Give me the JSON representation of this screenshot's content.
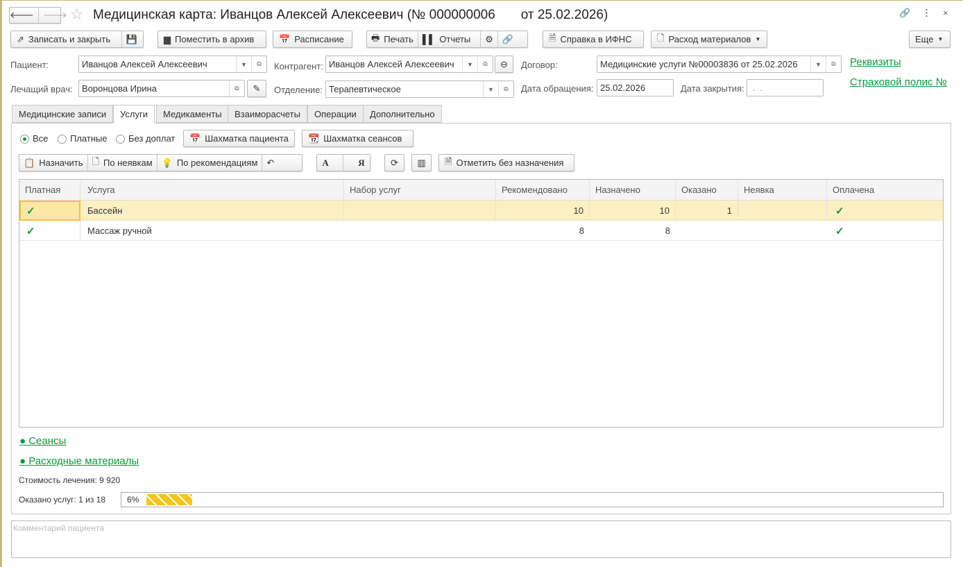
{
  "window": {
    "title": "Медицинская карта: Иванцов Алексей Алексеевич (№ 000000006       от 25.02.2026)"
  },
  "toolbar": {
    "save_close": "Записать и закрыть",
    "archive": "Поместить в архив",
    "schedule": "Расписание",
    "print": "Печать",
    "reports": "Отчеты",
    "ifns": "Справка в ИФНС",
    "materials": "Расход материалов",
    "more": "Еще"
  },
  "form": {
    "patient_label": "Пациент:",
    "patient": "Иванцов Алексей Алексеевич",
    "doctor_label": "Лечащий врач:",
    "doctor": "Воронцова Ирина",
    "contractor_label": "Контрагент:",
    "contractor": "Иванцов Алексей Алексеевич",
    "department_label": "Отделение:",
    "department": "Терапевтическое",
    "contract_label": "Договор:",
    "contract": "Медицинские услуги №00003836 от 25.02.2026",
    "visit_date_label": "Дата обращения:",
    "visit_date": "25.02.2026",
    "close_date_label": "Дата закрытия:",
    "close_date": " .  .",
    "requisites_link": "Реквизиты",
    "policy_link": "Страховой полис №"
  },
  "tabs": [
    "Медицинские записи",
    "Услуги",
    "Медикаменты",
    "Взаиморасчеты",
    "Операции",
    "Дополнительно"
  ],
  "filter": {
    "all": "Все",
    "paid": "Платные",
    "no_extra": "Без доплат",
    "selected": "Все"
  },
  "services_toolbar": {
    "patient_grid": "Шахматка пациента",
    "sessions_grid": "Шахматка сеансов",
    "assign": "Назначить",
    "no_show": "По неявкам",
    "recommend": "По рекомендациям",
    "sort_a": "А",
    "sort_z": "Я",
    "mark": "Отметить без назначения"
  },
  "table": {
    "headers": [
      "Платная",
      "Услуга",
      "Набор услуг",
      "Рекомендовано",
      "Назначено",
      "Оказано",
      "Неявка",
      "Оплачена"
    ],
    "rows": [
      {
        "paid": "✓",
        "service": "Бассейн",
        "set": "",
        "recommended": "10",
        "assigned": "10",
        "done": "1",
        "no_show": "",
        "payed": "✓"
      },
      {
        "paid": "✓",
        "service": "Массаж ручной",
        "set": "",
        "recommended": "8",
        "assigned": "8",
        "done": "",
        "no_show": "",
        "payed": "✓"
      }
    ]
  },
  "sessions_link": "● Сеансы",
  "materials_link": "● Расходные материалы",
  "cost": "Стоимость лечения: 9 920",
  "progress": {
    "label": "Оказано услуг: 1 из 18",
    "percent_text": "6%",
    "percent": 6
  },
  "comment_placeholder": "Комментарий пациента"
}
